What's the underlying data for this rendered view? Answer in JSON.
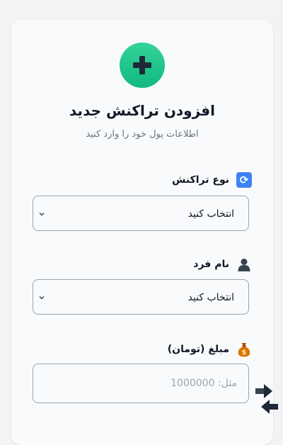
{
  "header": {
    "icon": "plus-icon",
    "title": "افزودن تراکنش جدید",
    "subtitle": "اطلاعات پول خود را وارد کنید"
  },
  "form": {
    "transaction_type": {
      "icon": "cycle-arrows-icon",
      "label": "نوع تراکنش",
      "selected": "انتخاب کنید"
    },
    "person_name": {
      "icon": "person-icon",
      "label": "نام فرد",
      "selected": "انتخاب کنید"
    },
    "amount": {
      "icon": "money-bag-icon",
      "label": "مبلغ (تومان)",
      "placeholder": "مثل: 1000000"
    }
  },
  "colors": {
    "accent_green": "#22c55e",
    "icon_blue": "#3b82f6"
  }
}
